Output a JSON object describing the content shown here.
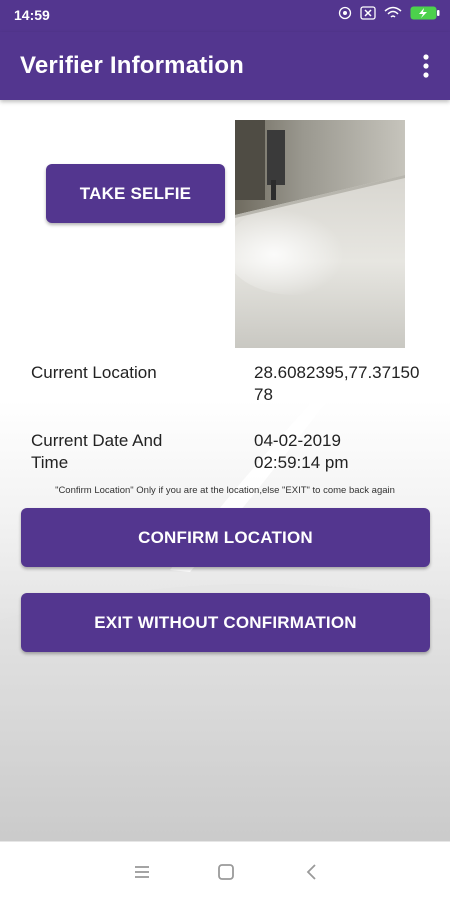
{
  "status_bar": {
    "time": "14:59",
    "icons": [
      "alarm-icon",
      "sim-off-icon",
      "wifi-icon",
      "battery-charging-icon"
    ]
  },
  "app_bar": {
    "title": "Verifier Information",
    "menu_icon": "more-vert-icon"
  },
  "selfie": {
    "button_label": "TAKE SELFIE"
  },
  "info": {
    "location_label": "Current Location",
    "location_value": "28.6082395,77.3715078",
    "datetime_label": "Current Date And Time",
    "date_value": "04-02-2019",
    "time_value": "02:59:14 pm"
  },
  "hint": "\"Confirm Location\" Only if you are at the location,else \"EXIT\" to come back again",
  "actions": {
    "confirm_label": "CONFIRM LOCATION",
    "exit_label": "EXIT WITHOUT CONFIRMATION"
  },
  "nav_bar": {
    "icons": [
      "menu-icon",
      "home-icon",
      "back-icon"
    ]
  },
  "colors": {
    "primary": "#53368f",
    "text": "#222222",
    "background": "#ffffff"
  }
}
